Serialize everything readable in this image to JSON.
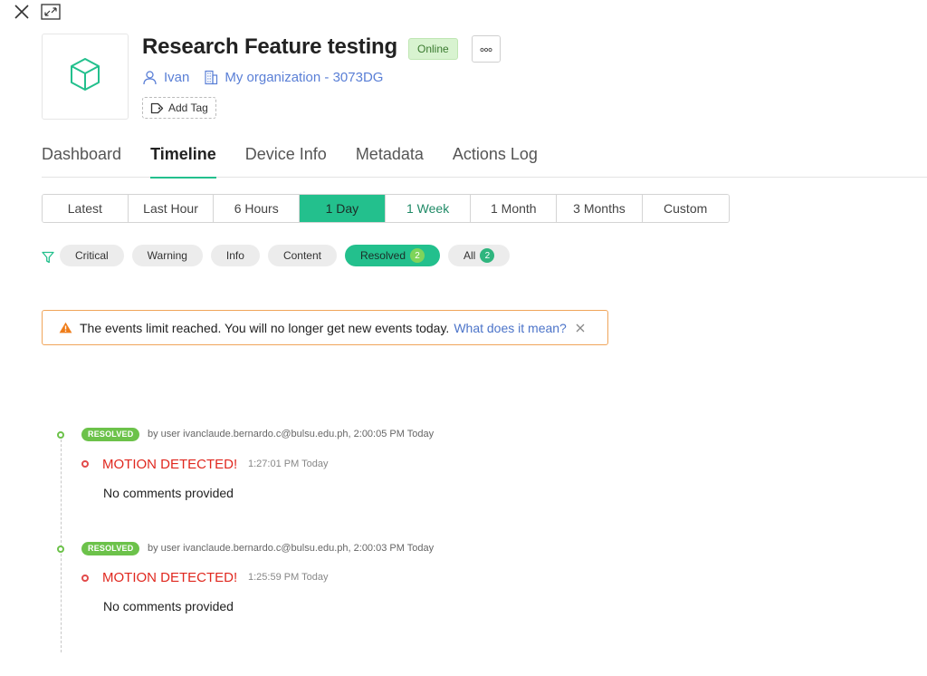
{
  "window": {
    "close_icon": "close-icon",
    "expand_icon": "expand-icon"
  },
  "device": {
    "icon": "cube-icon",
    "title": "Research Feature testing",
    "status": "Online",
    "more_icon": "more-dots-icon",
    "owner": "Ivan",
    "organization": "My organization - 3073DG",
    "add_tag_label": "Add Tag"
  },
  "tabs": [
    {
      "label": "Dashboard",
      "active": false
    },
    {
      "label": "Timeline",
      "active": true
    },
    {
      "label": "Device Info",
      "active": false
    },
    {
      "label": "Metadata",
      "active": false
    },
    {
      "label": "Actions Log",
      "active": false
    }
  ],
  "time_range": [
    {
      "label": "Latest"
    },
    {
      "label": "Last Hour"
    },
    {
      "label": "6 Hours"
    },
    {
      "label": "1 Day",
      "selected": true
    },
    {
      "label": "1 Week"
    },
    {
      "label": "1 Month"
    },
    {
      "label": "3 Months"
    },
    {
      "label": "Custom"
    }
  ],
  "filters": [
    {
      "label": "Critical"
    },
    {
      "label": "Warning"
    },
    {
      "label": "Info"
    },
    {
      "label": "Content"
    },
    {
      "label": "Resolved",
      "count": "2",
      "active": true
    },
    {
      "label": "All",
      "count": "2"
    }
  ],
  "alert": {
    "message": "The events limit reached. You will no longer get new events today.",
    "link": "What does it mean?"
  },
  "events": [
    {
      "resolved_label": "RESOLVED",
      "resolved_by": "by user ivanclaude.bernardo.c@bulsu.edu.ph, 2:00:05 PM Today",
      "title": "MOTION DETECTED!",
      "time": "1:27:01 PM Today",
      "comment": "No comments provided"
    },
    {
      "resolved_label": "RESOLVED",
      "resolved_by": "by user ivanclaude.bernardo.c@bulsu.edu.ph, 2:00:03 PM Today",
      "title": "MOTION DETECTED!",
      "time": "1:25:59 PM Today",
      "comment": "No comments provided"
    }
  ],
  "colors": {
    "accent": "#23c08d",
    "resolved": "#6cc24a",
    "event_title": "#e0281f",
    "link": "#5a7fd6",
    "alert_border": "#f0a55a"
  }
}
